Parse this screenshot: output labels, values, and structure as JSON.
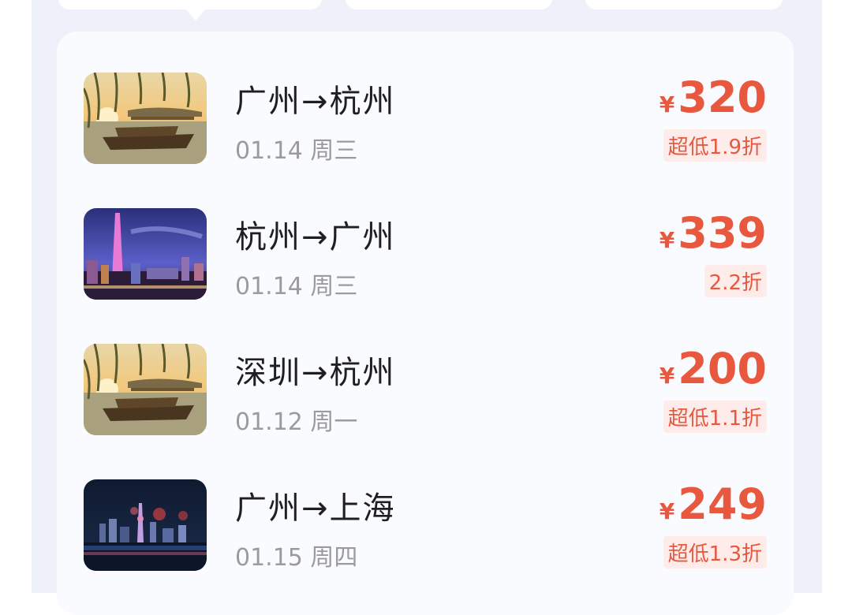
{
  "flights": [
    {
      "route": "广州→杭州",
      "date": "01.14 周三",
      "currency": "¥",
      "price": "320",
      "discount": "超低1.9折",
      "thumbnail": "west-lake-boat"
    },
    {
      "route": "杭州→广州",
      "date": "01.14 周三",
      "currency": "¥",
      "price": "339",
      "discount": "2.2折",
      "thumbnail": "canton-tower-night"
    },
    {
      "route": "深圳→杭州",
      "date": "01.12 周一",
      "currency": "¥",
      "price": "200",
      "discount": "超低1.1折",
      "thumbnail": "west-lake-boat"
    },
    {
      "route": "广州→上海",
      "date": "01.15 周四",
      "currency": "¥",
      "price": "249",
      "discount": "超低1.3折",
      "thumbnail": "shanghai-skyline-night"
    }
  ],
  "colors": {
    "price": "#e8583f",
    "discount_bg": "#fdecea",
    "page_bg": "#eef0fa",
    "card_bg": "#fafbff"
  }
}
